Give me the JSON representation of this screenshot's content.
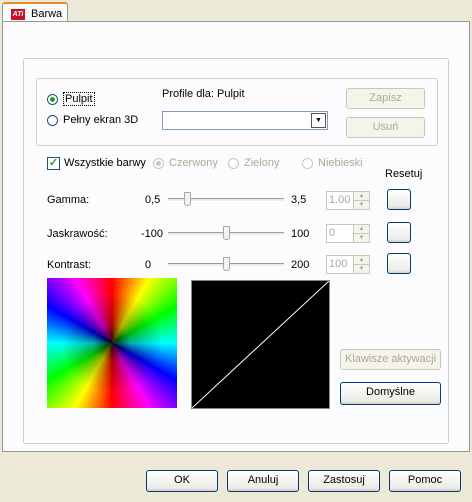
{
  "tab": {
    "label": "Barwa",
    "logo": "ATi"
  },
  "target": {
    "desktop_label": "Pulpit",
    "fullscreen_label": "Pełny ekran 3D",
    "selected": "desktop"
  },
  "profile": {
    "label": "Profile dla:",
    "target_value": "Pulpit",
    "selected_value": "",
    "save_label": "Zapisz",
    "delete_label": "Usuń"
  },
  "channels": {
    "all_label": "Wszystkie barwy",
    "all_checked": true,
    "red_label": "Czerwony",
    "green_label": "Zielony",
    "blue_label": "Niebieski"
  },
  "reset_label": "Resetuj",
  "gamma": {
    "label": "Gamma:",
    "min": "0,5",
    "max": "3,5",
    "value": "1.00",
    "level": 0.167
  },
  "brightness": {
    "label": "Jaskrawość:",
    "min": "-100",
    "max": "100",
    "value": "0",
    "level": 0.5
  },
  "contrast": {
    "label": "Kontrast:",
    "min": "0",
    "max": "200",
    "value": "100",
    "level": 0.5
  },
  "hotkeys_label": "Klawisze aktywacji",
  "defaults_label": "Domyślne",
  "footer": {
    "ok_label": "OK",
    "cancel_label": "Anuluj",
    "apply_label": "Zastosuj",
    "help_label": "Pomoc"
  },
  "icons": {
    "spin_up": "up-arrow-icon",
    "spin_down": "down-arrow-icon",
    "dropdown": "chevron-down-icon"
  }
}
